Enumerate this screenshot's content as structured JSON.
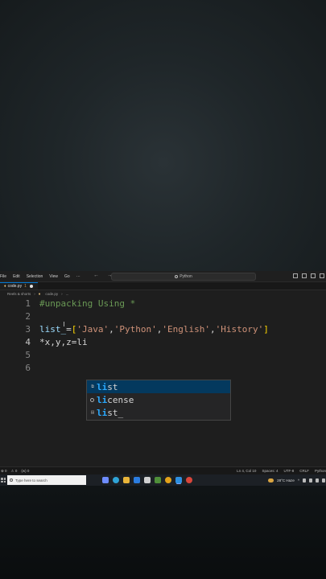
{
  "titlebar": {
    "menu": [
      "File",
      "Edit",
      "Selection",
      "View",
      "Go",
      "···"
    ],
    "nav_arrows": "← →",
    "search_text": "Python"
  },
  "tab": {
    "filename": "code.py",
    "problems": "1"
  },
  "breadcrumb": {
    "folder": "Reels & shorts",
    "file": "code.py",
    "more": "..."
  },
  "editor": {
    "line_numbers": [
      "1",
      "2",
      "3",
      "4",
      "5",
      "6"
    ],
    "active_line": 4,
    "line1": "#unpacking Using *",
    "line3": {
      "var": "list_",
      "eq": "=",
      "open": "[",
      "s1": "'Java'",
      "s2": "'Python'",
      "s3": "'English'",
      "s4": "'History'",
      "comma": ",",
      "close": "]"
    },
    "line4": "*x,y,z=li"
  },
  "suggestions": [
    {
      "icon": "class-icon",
      "match": "li",
      "rest": "st",
      "selected": true
    },
    {
      "icon": "variable-icon",
      "match": "li",
      "rest": "cense",
      "selected": false
    },
    {
      "icon": "snippet-icon",
      "match": "li",
      "rest": "st_",
      "selected": false
    }
  ],
  "statusbar": {
    "errors": "⊗ 0",
    "warnings": "⚠ 0",
    "ports": "(w) 0",
    "position": "Ln 4, Col 10",
    "spaces": "Spaces: 4",
    "encoding": "UTF-8",
    "eol": "CRLF",
    "language": "Python"
  },
  "taskbar": {
    "search_placeholder": "Type here to search",
    "weather": "28°C  Haze",
    "apps": [
      {
        "name": "widgets",
        "color": "#6e8cff"
      },
      {
        "name": "edge",
        "color": "#2fa3d6"
      },
      {
        "name": "file-explorer",
        "color": "#e8b43a"
      },
      {
        "name": "mail",
        "color": "#2b7de0"
      },
      {
        "name": "store",
        "color": "#d0d0d0"
      },
      {
        "name": "files",
        "color": "#4f8f3a"
      },
      {
        "name": "chrome",
        "color": "#e3a21a"
      },
      {
        "name": "vscode",
        "color": "#2d8fe0"
      },
      {
        "name": "recorder",
        "color": "#d9463b"
      }
    ]
  },
  "colors": {
    "accent": "#0078d4",
    "selection": "#04395e",
    "match": "#2aaaff"
  }
}
